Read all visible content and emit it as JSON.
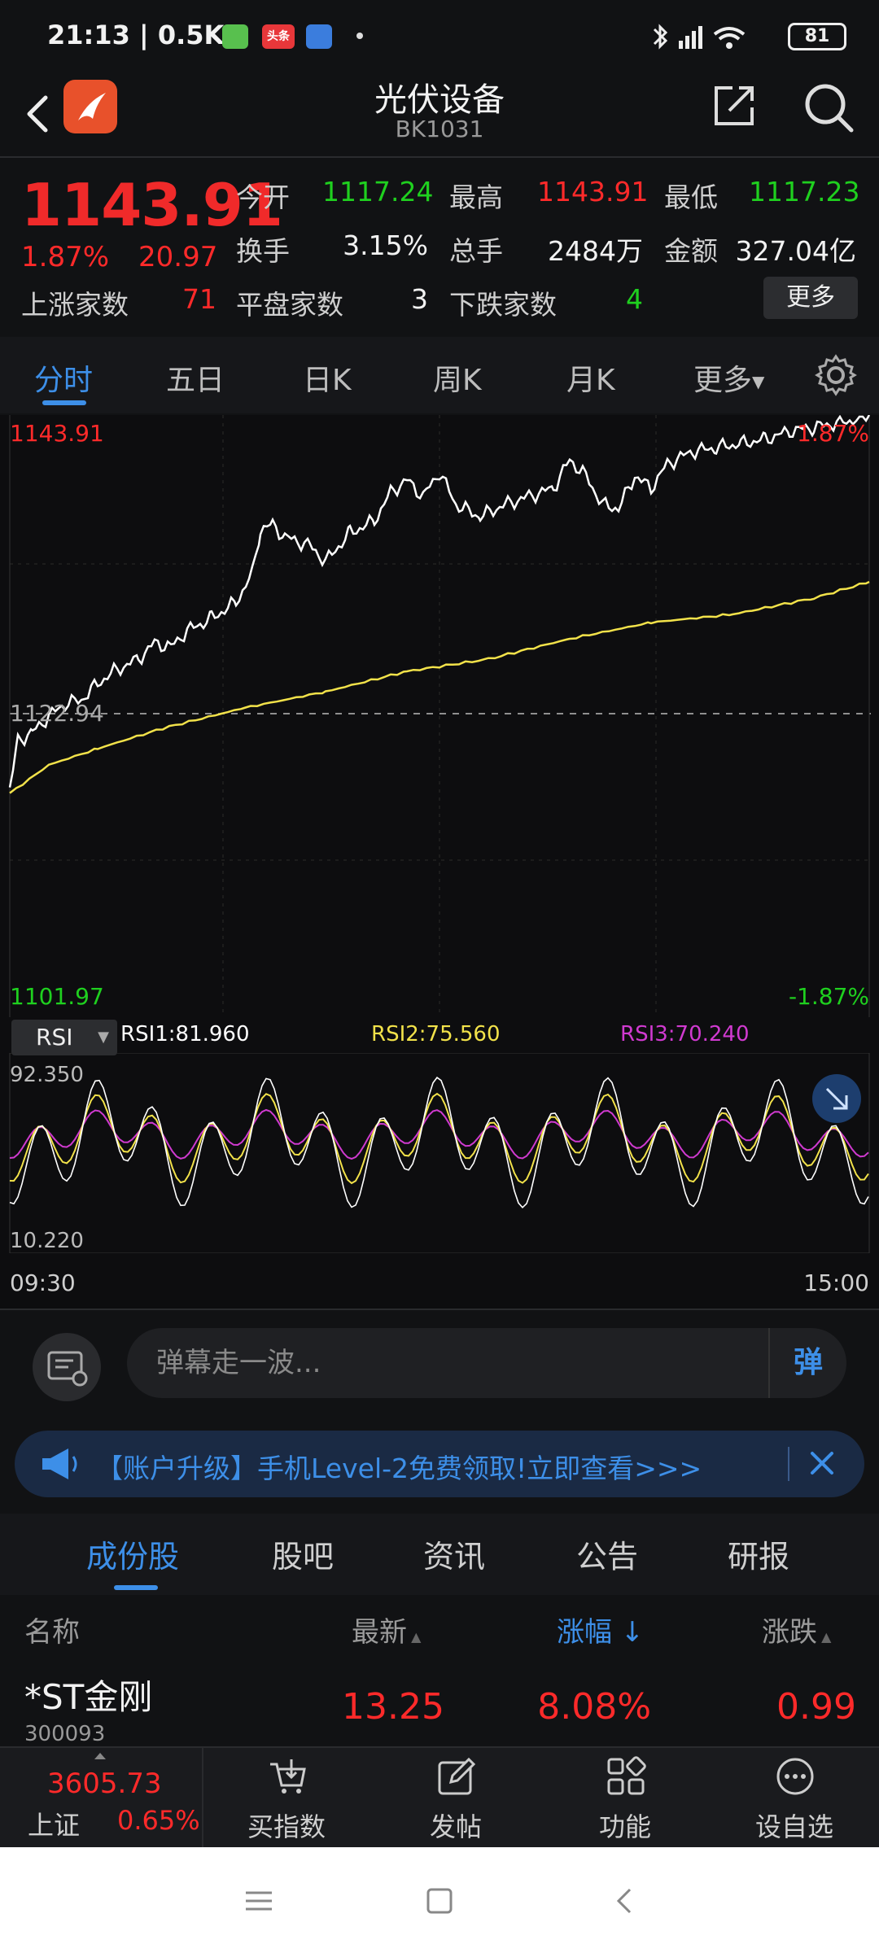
{
  "status_bar": {
    "time": "21:13 | 0.5K/s",
    "app2": "头条",
    "battery": "81"
  },
  "header": {
    "title": "光伏设备",
    "code": "BK1031"
  },
  "quote": {
    "price": "1143.91",
    "change_pct": "1.87%",
    "change": "20.97",
    "open_label": "今开",
    "open": "1117.24",
    "high_label": "最高",
    "high": "1143.91",
    "low_label": "最低",
    "low": "1117.23",
    "turnover_label": "换手",
    "turnover": "3.15%",
    "volume_label": "总手",
    "volume": "2484万",
    "amount_label": "金额",
    "amount": "327.04亿",
    "up_label": "上涨家数",
    "up": "71",
    "flat_label": "平盘家数",
    "flat": "3",
    "down_label": "下跌家数",
    "down": "4",
    "more": "更多"
  },
  "tabs": {
    "items": [
      "分时",
      "五日",
      "日K",
      "周K",
      "月K",
      "更多"
    ],
    "active": 0
  },
  "chart": {
    "max_label": "1143.91",
    "max_pct": "1.87%",
    "prev_close_label": "1122.94",
    "min_label": "1101.97",
    "min_pct": "-1.87%",
    "rsi_select": "RSI",
    "rsi1": "RSI1:81.960",
    "rsi2": "RSI2:75.560",
    "rsi3": "RSI3:70.240",
    "rsi_max": "92.350",
    "rsi_min": "10.220",
    "time_start": "09:30",
    "time_end": "15:00",
    "colors": {
      "price": "#ffffff",
      "avg": "#f2e24a",
      "rsi1": "#ffffff",
      "rsi2": "#f2e24a",
      "rsi3": "#d03ad0"
    }
  },
  "danmu": {
    "placeholder": "弹幕走一波...",
    "button": "弹"
  },
  "banner": {
    "text": "【账户升级】手机Level-2免费领取!立即查看>>>"
  },
  "subtabs": {
    "items": [
      "成份股",
      "股吧",
      "资讯",
      "公告",
      "研报"
    ],
    "active": 0
  },
  "list": {
    "headers": {
      "name": "名称",
      "latest": "最新",
      "pct": "涨幅",
      "change": "涨跌"
    },
    "rows": [
      {
        "name": "*ST金刚",
        "code": "300093",
        "latest": "13.25",
        "pct": "8.08%",
        "change": "0.99"
      }
    ]
  },
  "bottom_bar": {
    "index_value": "3605.73",
    "index_name": "上证",
    "index_pct": "0.65%",
    "items": [
      "买指数",
      "发帖",
      "功能",
      "设自选"
    ]
  }
}
